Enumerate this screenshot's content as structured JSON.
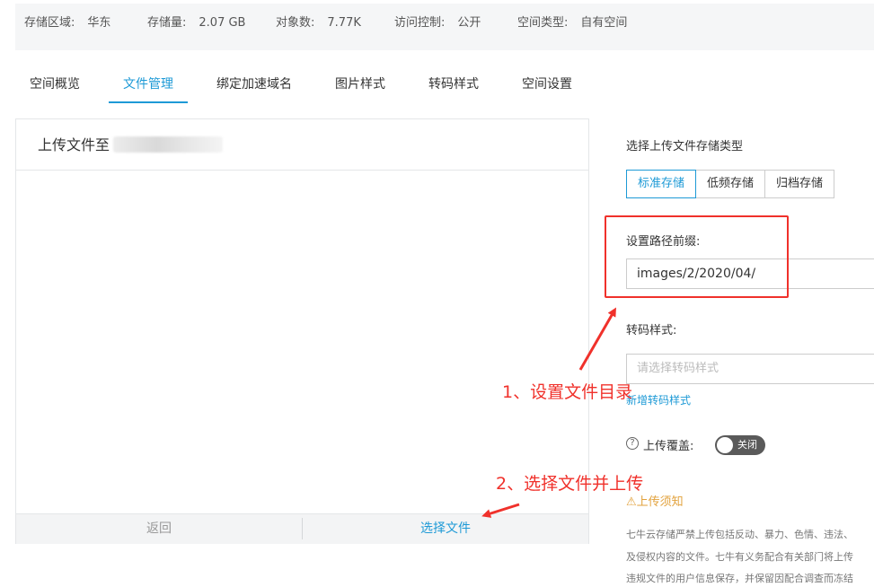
{
  "info_bar": [
    {
      "label": "存储区域:",
      "value": "华东"
    },
    {
      "label": "存储量:",
      "value": "2.07 GB"
    },
    {
      "label": "对象数:",
      "value": "7.77K"
    },
    {
      "label": "访问控制:",
      "value": "公开"
    },
    {
      "label": "空间类型:",
      "value": "自有空间"
    }
  ],
  "tabs": [
    {
      "label": "空间概览"
    },
    {
      "label": "文件管理",
      "active": true
    },
    {
      "label": "绑定加速域名"
    },
    {
      "label": "图片样式"
    },
    {
      "label": "转码样式"
    },
    {
      "label": "空间设置"
    }
  ],
  "upload_panel": {
    "title_prefix": "上传文件至",
    "back_button": "返回",
    "choose_button": "选择文件"
  },
  "storage_type": {
    "label": "选择上传文件存储类型",
    "options": [
      "标准存储",
      "低频存储",
      "归档存储"
    ],
    "selected": "标准存储"
  },
  "path_prefix": {
    "label": "设置路径前缀:",
    "value": "images/2/2020/04/"
  },
  "transcode": {
    "label": "转码样式:",
    "placeholder": "请选择转码样式",
    "add_link": "新增转码样式"
  },
  "overwrite": {
    "help_glyph": "?",
    "label": "上传覆盖:",
    "state": "关闭"
  },
  "notice": {
    "title": "上传须知",
    "lines": [
      "七牛云存储严禁上传包括反动、暴力、色情、违法、",
      "及侵权内容的文件。七牛有义务配合有关部门将上传",
      "违规文件的用户信息保存，并保留因配合调查而冻结"
    ]
  },
  "annotations": {
    "step1": "1、设置文件目录",
    "step2": "2、选择文件并上传"
  },
  "colors": {
    "accent": "#1e9ad6",
    "annotation": "#f0312b",
    "warning": "#e2a13b"
  }
}
